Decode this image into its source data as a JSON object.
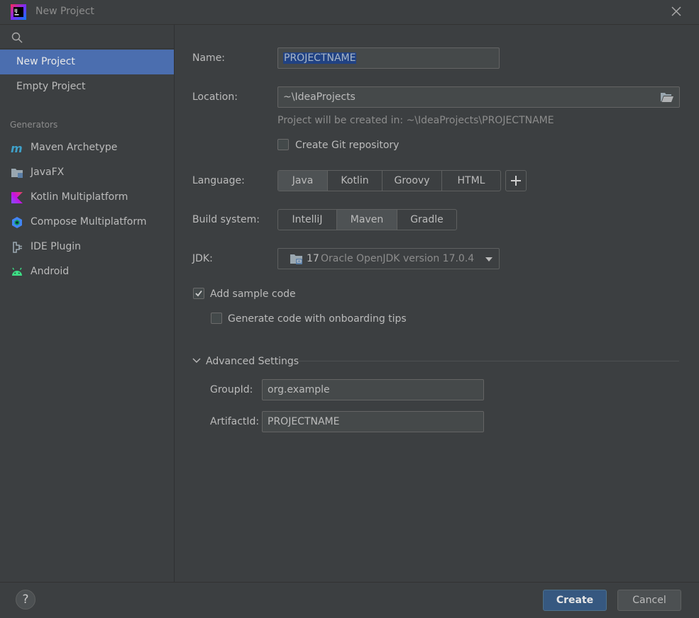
{
  "window": {
    "title": "New Project"
  },
  "sidebar": {
    "search": {
      "placeholder": "",
      "value": ""
    },
    "items": [
      {
        "label": "New Project",
        "selected": true
      },
      {
        "label": "Empty Project",
        "selected": false
      }
    ],
    "generators_header": "Generators",
    "generators": [
      {
        "label": "Maven Archetype",
        "icon": "maven-icon"
      },
      {
        "label": "JavaFX",
        "icon": "javafx-icon"
      },
      {
        "label": "Kotlin Multiplatform",
        "icon": "kotlin-icon"
      },
      {
        "label": "Compose Multiplatform",
        "icon": "compose-icon"
      },
      {
        "label": "IDE Plugin",
        "icon": "plugin-icon"
      },
      {
        "label": "Android",
        "icon": "android-icon"
      }
    ]
  },
  "form": {
    "name_label": "Name:",
    "name_value": "PROJECTNAME",
    "location_label": "Location:",
    "location_value": "~\\IdeaProjects",
    "location_hint": "Project will be created in: ~\\IdeaProjects\\PROJECTNAME",
    "git_label": "Create Git repository",
    "git_checked": false,
    "language_label": "Language:",
    "languages": [
      "Java",
      "Kotlin",
      "Groovy",
      "HTML"
    ],
    "language_selected": "Java",
    "build_label": "Build system:",
    "build_systems": [
      "IntelliJ",
      "Maven",
      "Gradle"
    ],
    "build_selected": "Maven",
    "jdk_label": "JDK:",
    "jdk_version": "17",
    "jdk_name": "Oracle OpenJDK version 17.0.4",
    "sample_code_label": "Add sample code",
    "sample_code_checked": true,
    "onboarding_label": "Generate code with onboarding tips",
    "onboarding_checked": false,
    "advanced_label": "Advanced Settings",
    "groupid_label": "GroupId:",
    "groupid_value": "org.example",
    "artifactid_label": "ArtifactId:",
    "artifactid_value": "PROJECTNAME"
  },
  "footer": {
    "help_label": "?",
    "create_label": "Create",
    "cancel_label": "Cancel"
  },
  "colors": {
    "background": "#3c3f41",
    "selection": "#4b6eaf",
    "primary_button": "#365880",
    "text": "#bbbbbb"
  }
}
